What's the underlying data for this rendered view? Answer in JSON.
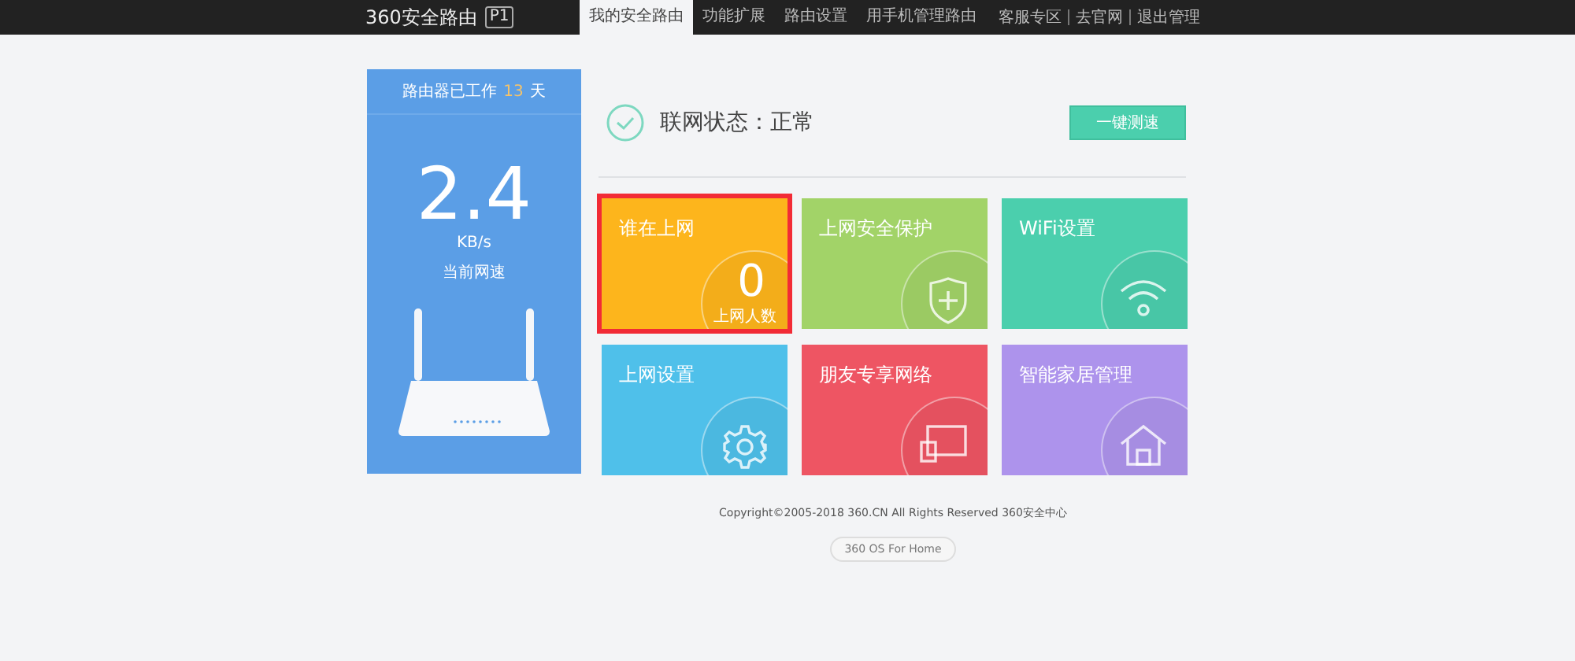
{
  "header": {
    "logo": "360安全路由",
    "model": "P1",
    "tabs": [
      {
        "label": "我的安全路由",
        "selected": true
      },
      {
        "label": "功能扩展",
        "selected": false
      },
      {
        "label": "路由设置",
        "selected": false
      },
      {
        "label": "用手机管理路由",
        "selected": false
      }
    ],
    "links": [
      "客服专区",
      "去官网",
      "退出管理"
    ]
  },
  "panel": {
    "uptime_prefix": "路由器已工作",
    "uptime_days": "13",
    "uptime_unit": "天",
    "speed": "2.4",
    "speed_unit": "KB/s",
    "speed_caption": "当前网速"
  },
  "status": {
    "label": "联网状态：正常",
    "button": "一键测速"
  },
  "tiles": [
    {
      "title": "谁在上网",
      "kind": "count",
      "color": "#fdb51c",
      "selected": true,
      "count": "0",
      "count_label": "上网人数"
    },
    {
      "title": "上网安全保护",
      "kind": "shield",
      "color": "#a2d368",
      "selected": false
    },
    {
      "title": "WiFi设置",
      "kind": "wifi",
      "color": "#4bcfad",
      "selected": false
    },
    {
      "title": "上网设置",
      "kind": "gear",
      "color": "#4fc0ea",
      "selected": false
    },
    {
      "title": "朋友专享网络",
      "kind": "devices",
      "color": "#ee5563",
      "selected": false
    },
    {
      "title": "智能家居管理",
      "kind": "home",
      "color": "#ad93ec",
      "selected": false
    }
  ],
  "footer": {
    "copyright": "Copyright©2005-2018 360.CN All Rights Reserved 360安全中心",
    "badge": "360 OS For Home"
  }
}
